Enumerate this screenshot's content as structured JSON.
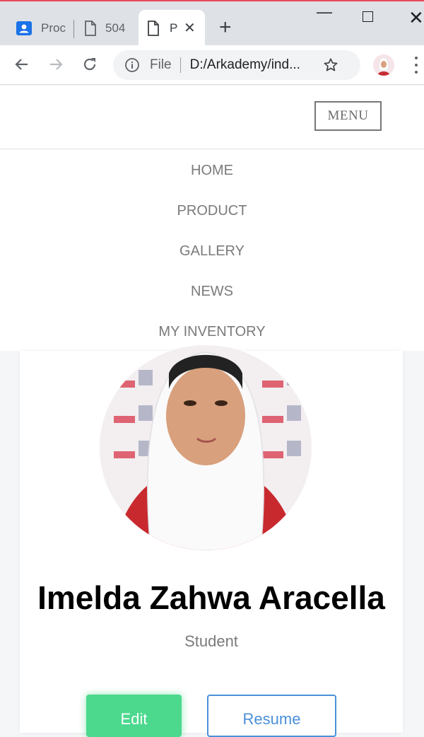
{
  "browser": {
    "tabs": [
      {
        "label": "Proc",
        "icon": "contact-icon"
      },
      {
        "label": "504",
        "icon": "file-icon"
      },
      {
        "label": "P",
        "icon": "file-icon",
        "active": true
      }
    ],
    "omnibox": {
      "scheme_label": "File",
      "url": "D:/Arkademy/ind..."
    }
  },
  "site": {
    "menu_button_label": "MENU",
    "nav_items": [
      "HOME",
      "PRODUCT",
      "GALLERY",
      "NEWS",
      "MY INVENTORY"
    ]
  },
  "profile": {
    "name": "Imelda Zahwa Aracella",
    "role": "Student",
    "edit_label": "Edit",
    "resume_label": "Resume"
  },
  "colors": {
    "accent_green": "#4cd98e",
    "accent_blue": "#4a90d9",
    "tab_highlight": "#e8485a"
  }
}
